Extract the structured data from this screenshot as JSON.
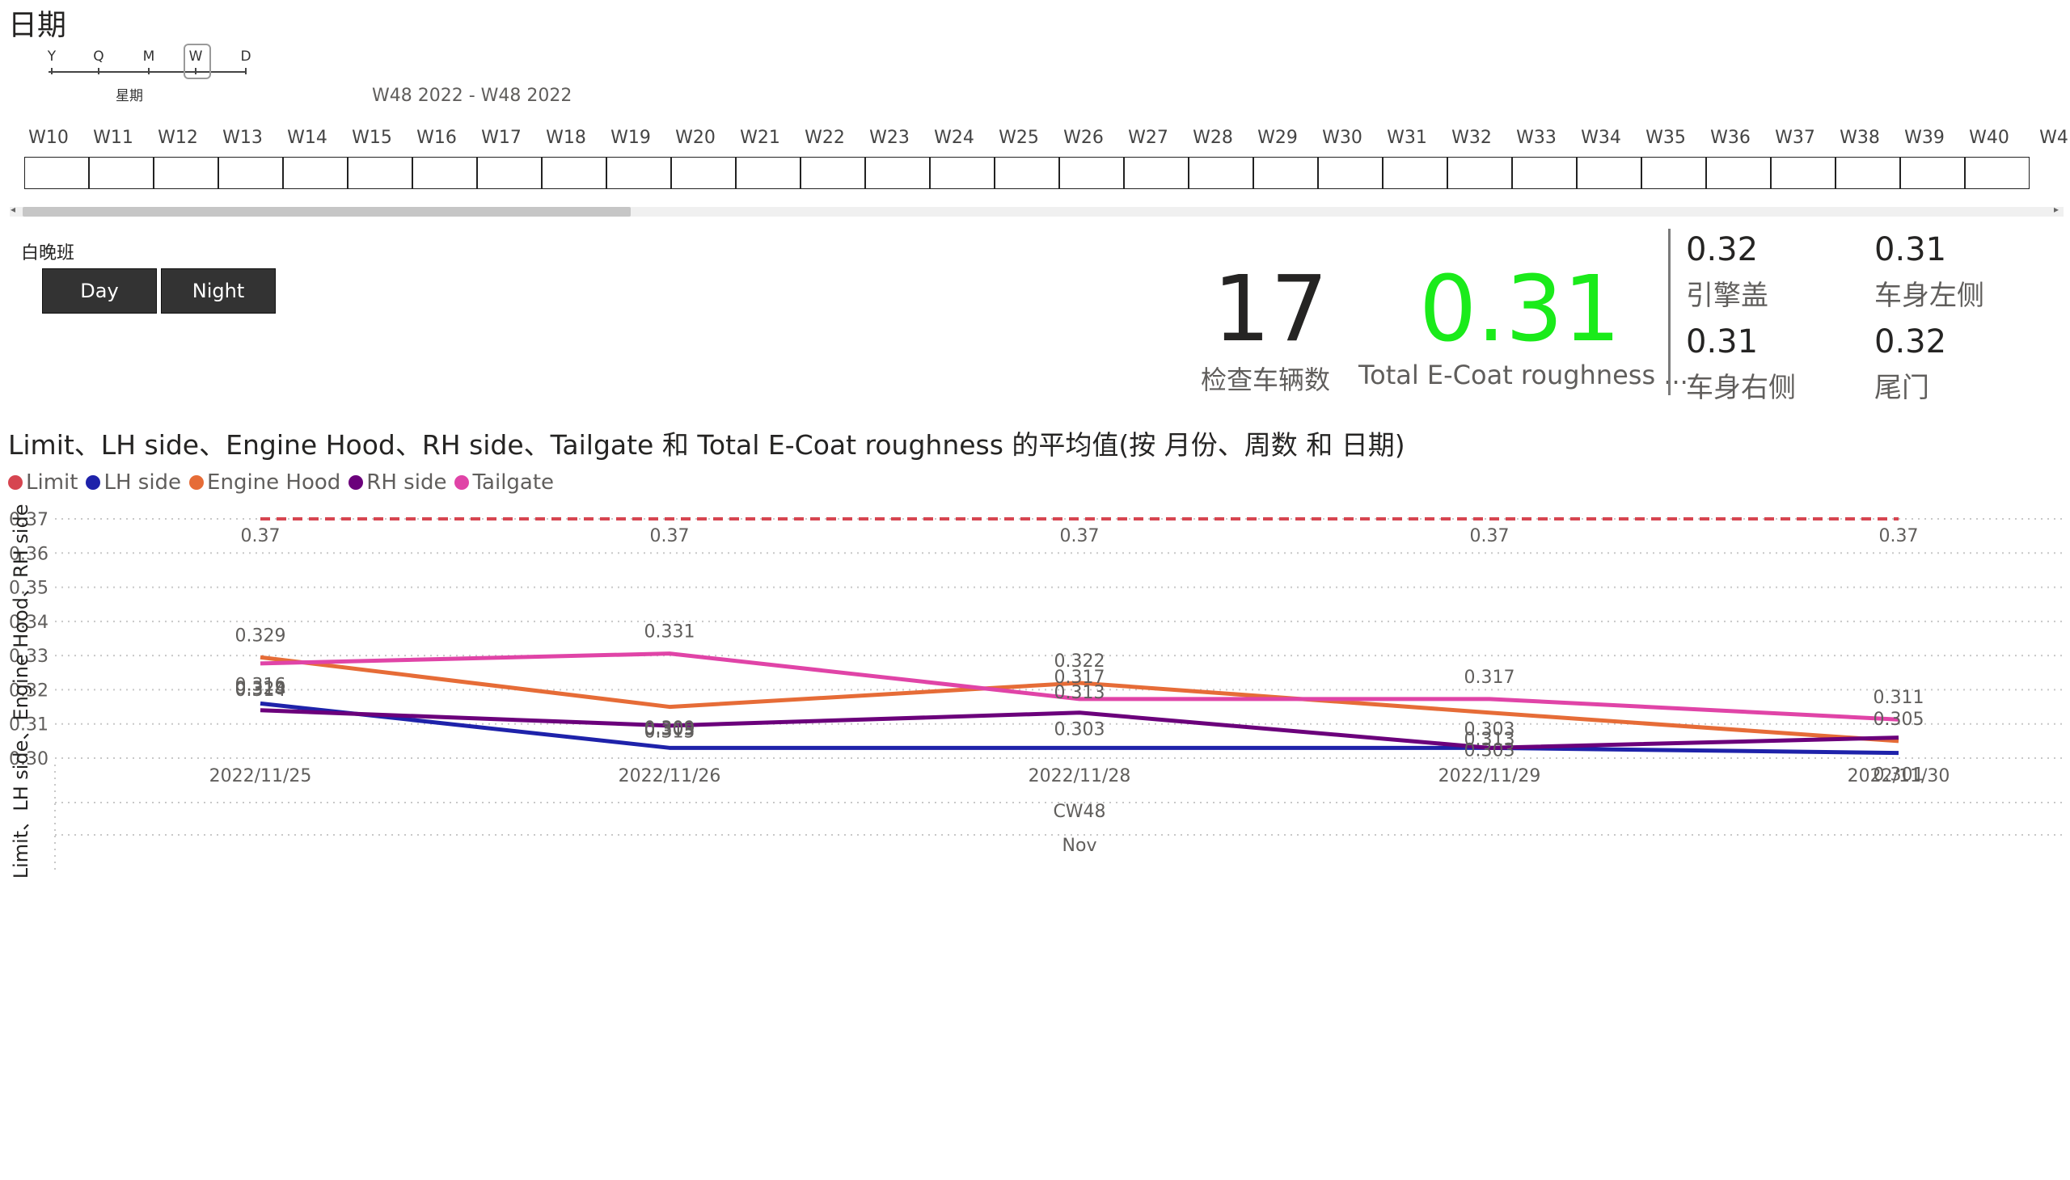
{
  "date_slicer": {
    "title": "日期",
    "granularity": [
      "Y",
      "Q",
      "M",
      "W",
      "D"
    ],
    "selected_granularity": "W",
    "granularity_label": "星期",
    "range_label": "W48 2022 - W48 2022",
    "weeks": [
      "W10",
      "W11",
      "W12",
      "W13",
      "W14",
      "W15",
      "W16",
      "W17",
      "W18",
      "W19",
      "W20",
      "W21",
      "W22",
      "W23",
      "W24",
      "W25",
      "W26",
      "W27",
      "W28",
      "W29",
      "W30",
      "W31",
      "W32",
      "W33",
      "W34",
      "W35",
      "W36",
      "W37",
      "W38",
      "W39",
      "W40",
      "W4"
    ]
  },
  "shift_slicer": {
    "title": "白晚班",
    "options": [
      "Day",
      "Night"
    ]
  },
  "kpi": {
    "vehicle_count": "17",
    "vehicle_count_label": "检查车辆数",
    "total_roughness": "0.31",
    "total_roughness_label": "Total E-Coat roughness ...",
    "total_color": "#1aeb1a",
    "parts": [
      {
        "value": "0.32",
        "label": "引擎盖"
      },
      {
        "value": "0.31",
        "label": "车身左侧"
      },
      {
        "value": "0.31",
        "label": "车身右侧"
      },
      {
        "value": "0.32",
        "label": "尾门"
      }
    ]
  },
  "chart_data": {
    "type": "line",
    "title": "Limit、LH side、Engine Hood、RH side、Tailgate 和 Total E-Coat roughness 的平均值(按 月份、周数 和 日期)",
    "ylabel": "Limit、LH side、Engine Hood、RH side 和 Tailga...",
    "ylim": [
      0.3,
      0.37
    ],
    "yticks": [
      "0.37",
      "0.36",
      "0.35",
      "0.34",
      "0.33",
      "0.32",
      "0.31",
      "0.30"
    ],
    "x": [
      "2022/11/25",
      "2022/11/26",
      "2022/11/28",
      "2022/11/29",
      "2022/11/30"
    ],
    "x_group_week": "CW48",
    "x_group_month": "Nov",
    "legend_position": "top-left",
    "series": [
      {
        "name": "Limit",
        "color": "#d64550",
        "dashed": true,
        "values": [
          0.37,
          0.37,
          0.37,
          0.37,
          0.37
        ],
        "labels": [
          "0.37",
          "0.37",
          "0.37",
          "0.37",
          "0.37"
        ]
      },
      {
        "name": "LH side",
        "color": "#1e22aa",
        "values": [
          0.316,
          0.303,
          0.303,
          0.303,
          0.3015
        ],
        "labels": [
          "0.316",
          "0.303",
          "0.303",
          "0.303",
          "0.301"
        ]
      },
      {
        "name": "Engine Hood",
        "color": "#e66c37",
        "values": [
          0.3295,
          0.315,
          0.322,
          0.3133,
          0.305
        ],
        "labels": [
          "0.329",
          "0.315",
          "0.322",
          "0.313",
          "0.305"
        ]
      },
      {
        "name": "RH side",
        "color": "#6b007b",
        "values": [
          0.314,
          0.3095,
          0.3133,
          0.303,
          0.306
        ],
        "labels": [
          "0.314",
          "0.309",
          "0.313",
          "0.303",
          ""
        ]
      },
      {
        "name": "Tailgate",
        "color": "#e044a7",
        "values": [
          0.3277,
          0.3306,
          0.3173,
          0.3173,
          0.3113
        ],
        "labels": [
          "0.328",
          "0.331",
          "0.317",
          "0.317",
          "0.311"
        ]
      }
    ]
  }
}
